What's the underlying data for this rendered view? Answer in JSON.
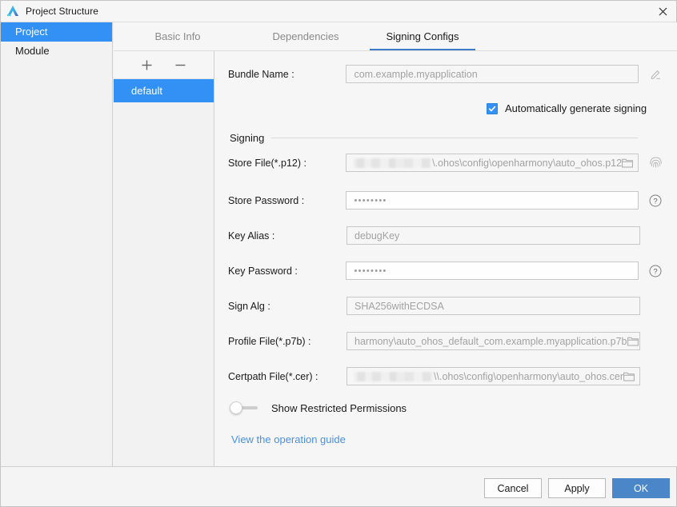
{
  "window": {
    "title": "Project Structure",
    "logo_icon": "deveco-logo-icon",
    "close_icon": "close-icon"
  },
  "sidebar": {
    "items": [
      {
        "label": "Project",
        "selected": true
      },
      {
        "label": "Module",
        "selected": false
      }
    ]
  },
  "tabs": [
    {
      "label": "Basic Info",
      "active": false
    },
    {
      "label": "Dependencies",
      "active": false
    },
    {
      "label": "Signing Configs",
      "active": true
    }
  ],
  "config_panel": {
    "add_icon": "plus-icon",
    "remove_icon": "minus-icon",
    "items": [
      {
        "label": "default",
        "selected": true
      }
    ]
  },
  "form": {
    "bundle_name": {
      "label": "Bundle Name :",
      "value": "com.example.myapplication",
      "edit_icon": "pencil-icon"
    },
    "auto_sign": {
      "label": "Automatically generate signing",
      "checked": true
    },
    "section_title": "Signing",
    "store_file": {
      "label": "Store File(*.p12) :",
      "value": "\\.ohos\\config\\openharmony\\auto_ohos.p12",
      "redacted": true,
      "browse_icon": "folder-icon",
      "side_icon": "fingerprint-icon"
    },
    "store_password": {
      "label": "Store Password :",
      "value": "••••••••",
      "side_icon": "help-icon"
    },
    "key_alias": {
      "label": "Key Alias :",
      "value": "debugKey"
    },
    "key_password": {
      "label": "Key Password :",
      "value": "••••••••",
      "side_icon": "help-icon"
    },
    "sign_alg": {
      "label": "Sign Alg :",
      "value": "SHA256withECDSA"
    },
    "profile_file": {
      "label": "Profile File(*.p7b) :",
      "value": "harmony\\auto_ohos_default_com.example.myapplication.p7b",
      "browse_icon": "folder-icon"
    },
    "certpath_file": {
      "label": "Certpath File(*.cer) :",
      "value": "\\\\.ohos\\config\\openharmony\\auto_ohos.cer",
      "redacted": true,
      "browse_icon": "folder-icon"
    },
    "show_restricted": {
      "label": "Show Restricted Permissions",
      "enabled": false
    },
    "guide_link": "View the operation guide"
  },
  "footer": {
    "cancel": "Cancel",
    "apply": "Apply",
    "ok": "OK"
  },
  "colors": {
    "accent_blue": "#3391f5",
    "tab_underline": "#3d7cc9",
    "ok_button": "#4a86c8",
    "link": "#4a90e2"
  }
}
